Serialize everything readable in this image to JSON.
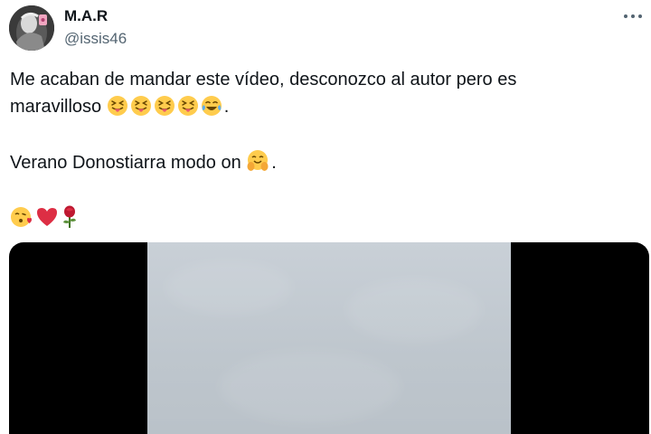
{
  "author": {
    "name": "M.A.R",
    "handle": "@issis46"
  },
  "menu": {
    "icon": "more-horizontal-icon"
  },
  "body": {
    "line1": "Me acaban de mandar este vídeo, desconozco al autor pero es",
    "line2": "maravilloso",
    "line2_emojis": [
      "squinting-tongue-emoji",
      "squinting-tongue-emoji",
      "squinting-tongue-emoji",
      "squinting-tongue-emoji",
      "tears-of-joy-emoji"
    ],
    "line2_end": ".",
    "line3": "Verano Donostiarra modo on",
    "line3_emoji": "hugging-face-emoji",
    "line3_end": ".",
    "line4_emojis": [
      "kissing-heart-emoji",
      "red-heart-emoji",
      "rose-emoji"
    ]
  },
  "media": {
    "type": "video",
    "letterbox_color": "#000000"
  }
}
